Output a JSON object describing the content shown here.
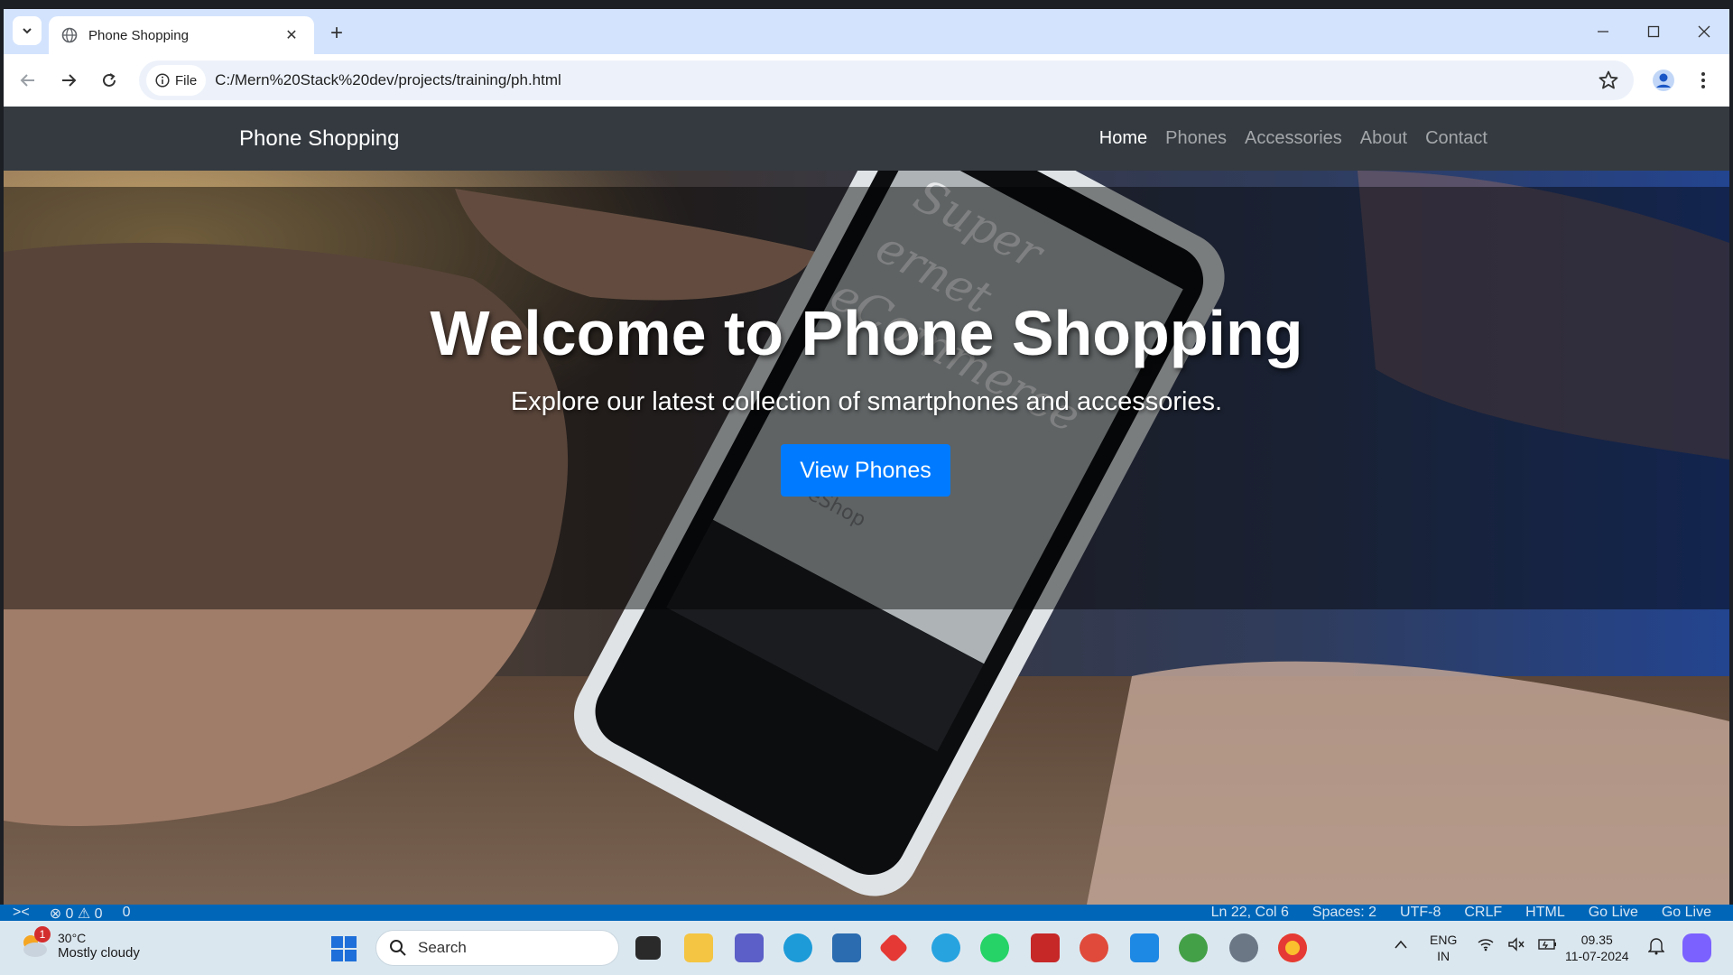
{
  "browser": {
    "tab_title": "Phone Shopping",
    "site_chip": "File",
    "url": "C:/Mern%20Stack%20dev/projects/training/ph.html"
  },
  "page": {
    "brand": "Phone Shopping",
    "nav": [
      {
        "label": "Home",
        "active": true
      },
      {
        "label": "Phones",
        "active": false
      },
      {
        "label": "Accessories",
        "active": false
      },
      {
        "label": "About",
        "active": false
      },
      {
        "label": "Contact",
        "active": false
      }
    ],
    "hero": {
      "title": "Welcome to Phone Shopping",
      "subtitle": "Explore our latest collection of smartphones and accessories.",
      "cta": "View Phones",
      "background_text": [
        "Super",
        "ernet",
        "eCommerce",
        "eShop"
      ]
    },
    "colors": {
      "navbar": "#343a40",
      "button": "#007bff",
      "chrome": "#d3e3fd"
    }
  },
  "statusbar": {
    "problems": "⊗ 0 ⚠ 0",
    "ports": "0",
    "position": "Ln 22, Col 6",
    "spaces": "Spaces: 2",
    "encoding": "UTF-8",
    "eol": "CRLF",
    "language": "HTML",
    "golive1": "Go Live",
    "golive2": "Go Live"
  },
  "taskbar": {
    "weather_temp": "30°C",
    "weather_desc": "Mostly cloudy",
    "weather_badge": "1",
    "search_placeholder": "Search",
    "lang_line1": "ENG",
    "lang_line2": "IN",
    "time": "09.35",
    "date": "11-07-2024",
    "icons": [
      "task-view-icon",
      "file-explorer-icon",
      "teams-icon",
      "edge-icon",
      "store-icon",
      "app-diamond-icon",
      "pinned-app-icon",
      "whatsapp-icon",
      "mcafee-icon",
      "chrome-profile-icon",
      "vscode-icon",
      "chrome-dev-icon",
      "settings-icon",
      "chrome-icon"
    ]
  }
}
